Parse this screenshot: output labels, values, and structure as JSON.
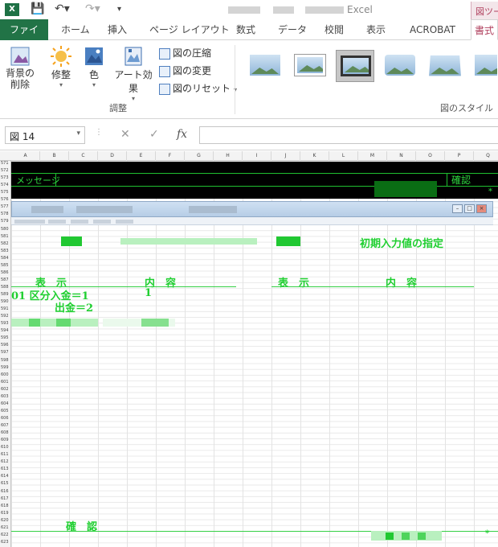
{
  "app": {
    "title": "Excel",
    "icon": "excel-icon",
    "context_tab": "図ツール"
  },
  "quick_access": {
    "save_icon": "save-icon",
    "undo_icon": "undo-icon",
    "redo_icon": "redo-icon",
    "customize_icon": "customize-qat-icon"
  },
  "tabs": [
    "ファイル",
    "ホーム",
    "挿入",
    "ページ レイアウト",
    "数式",
    "データ",
    "校閲",
    "表示",
    "ACROBAT",
    "書式"
  ],
  "ribbon": {
    "remove_background": "背景の\n削除",
    "corrections": "修整",
    "color": "色",
    "artistic_effects": "アート効果",
    "compress": "図の圧縮",
    "change_picture": "図の変更",
    "reset_picture": "図のリセット",
    "adjust_group": "調整",
    "styles_group": "図のスタイル"
  },
  "formula_bar": {
    "name_box": "図 14",
    "cancel": "✕",
    "enter": "✓",
    "function": "fx",
    "formula": ""
  },
  "columns": [
    "A",
    "B",
    "C",
    "D",
    "E",
    "F",
    "G",
    "H",
    "I",
    "J",
    "K",
    "L",
    "M",
    "N",
    "O",
    "P",
    "Q"
  ],
  "rows": [
    "571",
    "572",
    "573",
    "574",
    "575",
    "576",
    "577",
    "578",
    "579",
    "580",
    "581",
    "582",
    "583",
    "584",
    "585",
    "586",
    "587",
    "588",
    "589",
    "590",
    "591",
    "592",
    "593",
    "594",
    "595",
    "596",
    "597",
    "598",
    "599",
    "600",
    "601",
    "602",
    "603",
    "604",
    "605",
    "606",
    "607",
    "608",
    "609",
    "610",
    "611",
    "612",
    "613",
    "614",
    "615",
    "616",
    "617",
    "618",
    "619",
    "620",
    "621",
    "622",
    "623"
  ],
  "message_band": {
    "label": "メッセージ",
    "confirm": "確認",
    "mark": "*"
  },
  "screen": {
    "heading_right": "初期入力値の指定",
    "col_display_1": "表　示",
    "col_content_1": "内　容",
    "col_display_2": "表　示",
    "col_content_2": "内　容",
    "row1_display": "01 区分入金＝1",
    "row1_content": "1",
    "row2_display": "出金＝2",
    "confirm": "確　認",
    "mark": "*"
  },
  "colors": {
    "excel_green": "#217346",
    "screen_green": "#1fcf30",
    "context_pink": "#b0405e"
  }
}
